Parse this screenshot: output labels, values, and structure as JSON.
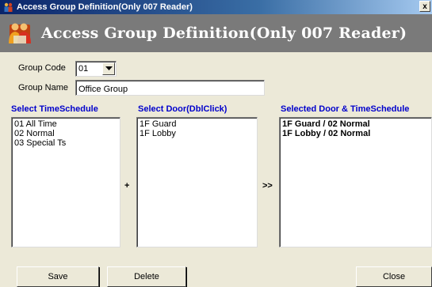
{
  "window": {
    "title": "Access Group Definition(Only 007 Reader)",
    "close_glyph": "x"
  },
  "banner": {
    "title": "Access Group Definition(Only 007 Reader)",
    "icon": "users-icon"
  },
  "form": {
    "group_code_label": "Group Code",
    "group_code_value": "01",
    "group_name_label": "Group Name",
    "group_name_value": "Office Group"
  },
  "timeschedule": {
    "header": "Select TimeSchedule",
    "items": [
      "01 All Time",
      "02 Normal",
      "03 Special Ts"
    ]
  },
  "plus_label": "+",
  "doors": {
    "header": "Select Door(DblClick)",
    "items": [
      "1F Guard",
      "1F Lobby"
    ]
  },
  "move_label": ">>",
  "selected": {
    "header": "Selected Door & TimeSchedule",
    "items": [
      "1F Guard / 02 Normal",
      "1F Lobby / 02 Normal"
    ]
  },
  "buttons": {
    "save": "Save",
    "delete": "Delete",
    "close": "Close"
  }
}
